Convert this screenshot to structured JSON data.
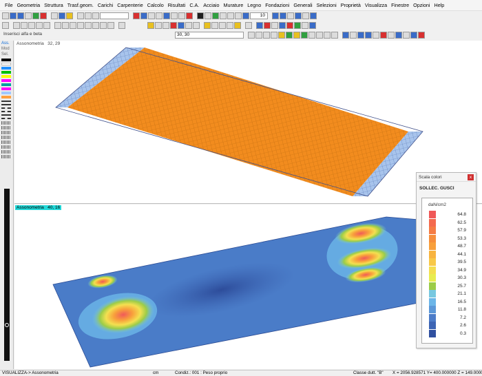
{
  "menu": [
    "File",
    "Geometria",
    "Struttura",
    "Trasf.geom.",
    "Carichi",
    "Carpenterie",
    "Calcolo",
    "Risultati",
    "C.A.",
    "Acciaio",
    "Murature",
    "Legno",
    "Fondazioni",
    "Generali",
    "Selezioni",
    "Proprietà",
    "Visualizza",
    "Finestre",
    "Opzioni",
    "Help"
  ],
  "toolbar": {
    "zoom_value": "10",
    "angle_prompt": "Inserisci alfa e beta",
    "angle_value": "30, 30"
  },
  "left_panel": {
    "tabs": [
      "Ass.",
      "Mod",
      "Sel."
    ],
    "swatches": [
      "#000000",
      "#ffffff",
      "#1e90ff",
      "#00c000",
      "#ffff00",
      "#ff00ff",
      "#00a0a0",
      "#ff00ff",
      "#a0c8ff",
      "#ffa040"
    ]
  },
  "views": {
    "top": {
      "label": "Assonometria",
      "angles": "32, 29"
    },
    "bottom": {
      "label": "Assonometria",
      "angles": "40, 16"
    }
  },
  "palette": {
    "title": "Scala colori",
    "close": "x",
    "heading": "SOLLEC. GUSCI",
    "unit": "daN/cm2",
    "levels": [
      {
        "value": "64.8",
        "color": "#f05858"
      },
      {
        "value": "62.5",
        "color": "#f46a4e"
      },
      {
        "value": "57.9",
        "color": "#f57c44"
      },
      {
        "value": "53.3",
        "color": "#f68e3c"
      },
      {
        "value": "48.7",
        "color": "#f8a03c"
      },
      {
        "value": "44.1",
        "color": "#f8b440"
      },
      {
        "value": "39.5",
        "color": "#f8c848"
      },
      {
        "value": "34.9",
        "color": "#f4de50"
      },
      {
        "value": "30.3",
        "color": "#e8ec50"
      },
      {
        "value": "25.7",
        "color": "#9ccc48"
      },
      {
        "value": "21.1",
        "color": "#78c8e0"
      },
      {
        "value": "16.5",
        "color": "#6cb6e8"
      },
      {
        "value": "11.8",
        "color": "#5c98d8"
      },
      {
        "value": "7.2",
        "color": "#4c7cc8"
      },
      {
        "value": "2.6",
        "color": "#3c64b4"
      },
      {
        "value": "0.3",
        "color": "#3050a0"
      }
    ]
  },
  "status": {
    "mode": "VISUALIZZA-> Assonometria",
    "unit": "cm",
    "condition": "Condiz.: 001 : Peso proprio",
    "class": "Classe dutt. \"B\"",
    "coords": "X = 2056.928571 Y= 400.000000 Z = 149.000000"
  }
}
